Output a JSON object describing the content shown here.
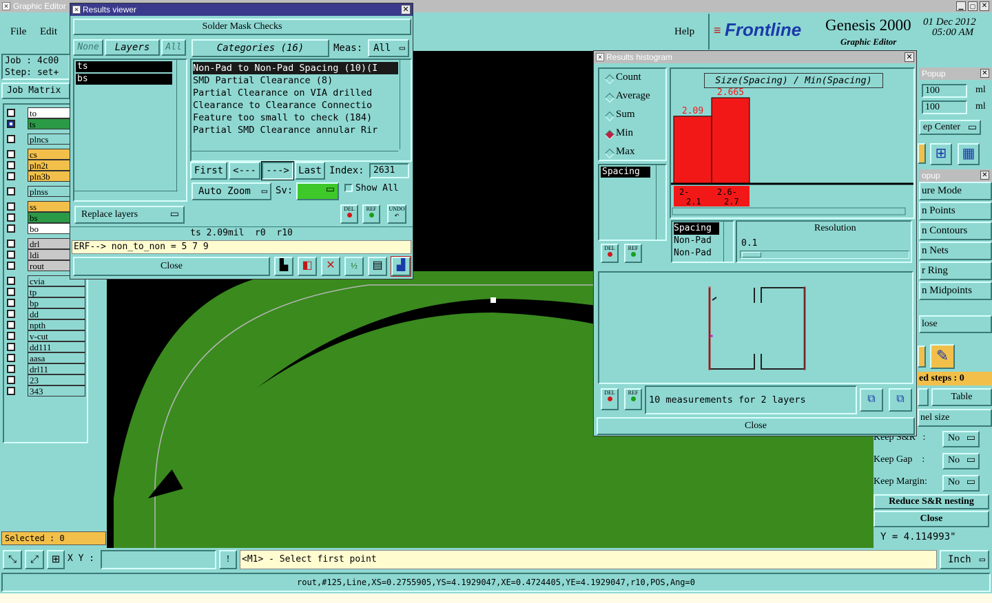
{
  "main_window": {
    "title": "Graphic Editor"
  },
  "menu": {
    "file": "File",
    "edit": "Edit",
    "help": "Help"
  },
  "brand": {
    "logo": "Frontline",
    "product": "Genesis 2000",
    "subtitle": "Graphic Editor",
    "date": "01 Dec 2012",
    "time": "05:00 AM"
  },
  "left_panel": {
    "job_label": "Job : 4c00",
    "step_label": "Step: set+",
    "job_matrix_button": "Job Matrix",
    "layers": [
      {
        "name": "to",
        "color": "#ffffff",
        "checked": false
      },
      {
        "name": "ts",
        "color": "#2a9a46",
        "checked": true
      },
      {
        "name": "plncs",
        "color": "#8fd8d2",
        "checked": false
      },
      {
        "name": "cs",
        "color": "#f2c04a",
        "checked": false
      },
      {
        "name": "pln2t",
        "color": "#f2c04a",
        "checked": false
      },
      {
        "name": "pln3b",
        "color": "#f2c04a",
        "checked": false
      },
      {
        "name": "plnss",
        "color": "#8fd8d2",
        "checked": false
      },
      {
        "name": "ss",
        "color": "#f2c04a",
        "checked": false
      },
      {
        "name": "bs",
        "color": "#2a9a46",
        "checked": false
      },
      {
        "name": "bo",
        "color": "#ffffff",
        "checked": false
      },
      {
        "name": "drl",
        "color": "#c8c8c8",
        "checked": false
      },
      {
        "name": "ldi",
        "color": "#c8c8c8",
        "checked": false
      },
      {
        "name": "rout",
        "color": "#c8c8c8",
        "checked": false
      },
      {
        "name": "cvia",
        "color": "#8fd8d2",
        "checked": false
      },
      {
        "name": "tp",
        "color": "#8fd8d2",
        "checked": false
      },
      {
        "name": "bp",
        "color": "#8fd8d2",
        "checked": false
      },
      {
        "name": "dd",
        "color": "#8fd8d2",
        "checked": false
      },
      {
        "name": "npth",
        "color": "#8fd8d2",
        "checked": false
      },
      {
        "name": "v-cut",
        "color": "#8fd8d2",
        "checked": false
      },
      {
        "name": "dd111",
        "color": "#8fd8d2",
        "checked": false
      },
      {
        "name": "aasa",
        "color": "#8fd8d2",
        "checked": false
      },
      {
        "name": "drl11",
        "color": "#8fd8d2",
        "checked": false
      },
      {
        "name": "23",
        "color": "#8fd8d2",
        "checked": false
      },
      {
        "name": "343",
        "color": "#8fd8d2",
        "checked": false
      }
    ],
    "selected": "Selected : 0"
  },
  "results_viewer": {
    "title": "Results viewer",
    "header": "Solder Mask Checks",
    "none_button": "None",
    "layers_button": "Layers",
    "all_button": "All",
    "layer_list": [
      "ts",
      "bs"
    ],
    "categories_button": "Categories (16)",
    "meas_label": "Meas:",
    "meas_value": "All",
    "categories": [
      "Non-Pad to Non-Pad Spacing (10)(I",
      "SMD Partial Clearance (8)",
      "Partial Clearance on VIA drilled",
      "Clearance to Clearance Connectio",
      "Feature too small to check (184)",
      "Partial SMD Clearance annular Rir"
    ],
    "first_button": "First",
    "prev_button": "<---",
    "next_button": "--->",
    "last_button": "Last",
    "index_label": "Index:",
    "index_value": "2631",
    "auto_zoom": "Auto Zoom",
    "sv_label": "Sv:",
    "show_all": "Show All",
    "replace_layers": "Replace layers",
    "del": "DEL",
    "ref": "REF",
    "undo": "UNDO",
    "status": "ts 2.09mil  r0  r10",
    "erf_line": "ERF--> non_to_non = 5 7 9",
    "close": "Close"
  },
  "histogram": {
    "title": "Results histogram",
    "modes": [
      {
        "label": "Count",
        "selected": false
      },
      {
        "label": "Average",
        "selected": false
      },
      {
        "label": "Sum",
        "selected": false
      },
      {
        "label": "Min",
        "selected": true
      },
      {
        "label": "Max",
        "selected": false
      }
    ],
    "param_list": [
      "Spacing"
    ],
    "chart_title": "Size(Spacing) / Min(Spacing)",
    "bars": [
      {
        "value_label": "2.09",
        "range_top": "2-",
        "range_bottom": "2.1",
        "value": 2.09
      },
      {
        "value_label": "2.665",
        "range_top": "2.6-",
        "range_bottom": "2.7",
        "value": 2.665
      }
    ],
    "type_list": [
      "Spacing",
      "Non-Pad",
      "Non-Pad"
    ],
    "resolution_label": "Resolution",
    "resolution_value": "0.1",
    "measurements": "10 measurements for 2 layers",
    "del": "DEL",
    "ref": "REF",
    "close": "Close"
  },
  "right_panel": {
    "popup_title_1": "Popup",
    "val1": "100",
    "unit1": "ml",
    "val2": "100",
    "unit2": "ml",
    "step_center": "ep Center",
    "popup_title_2": "opup",
    "items": [
      "ure Mode",
      "n Points",
      "n Contours",
      "n Nets",
      "r Ring",
      "n Midpoints"
    ],
    "close_1": "lose",
    "used_steps": "ed steps : 0",
    "table_button": "Table",
    "panel_size": "nel size",
    "keep_sr_label": "Keep S&R   :",
    "keep_sr_value": "No",
    "keep_gap_label": "Keep Gap    :",
    "keep_gap_value": "No",
    "keep_margin_label": "Keep Margin:",
    "keep_margin_value": "No",
    "reduce_button": "Reduce S&R nesting",
    "close_2": "Close",
    "y_readout": "Y = 4.114993\""
  },
  "bottom": {
    "xy_label": "X Y :",
    "xy_value": "",
    "bang": "!",
    "prompt": "<M1> - Select first point",
    "units": "Inch",
    "feature_info": "rout,#125,Line,XS=0.2755905,YS=4.1929047,XE=0.4724405,YE=4.1929047,r10,POS,Ang=0"
  }
}
